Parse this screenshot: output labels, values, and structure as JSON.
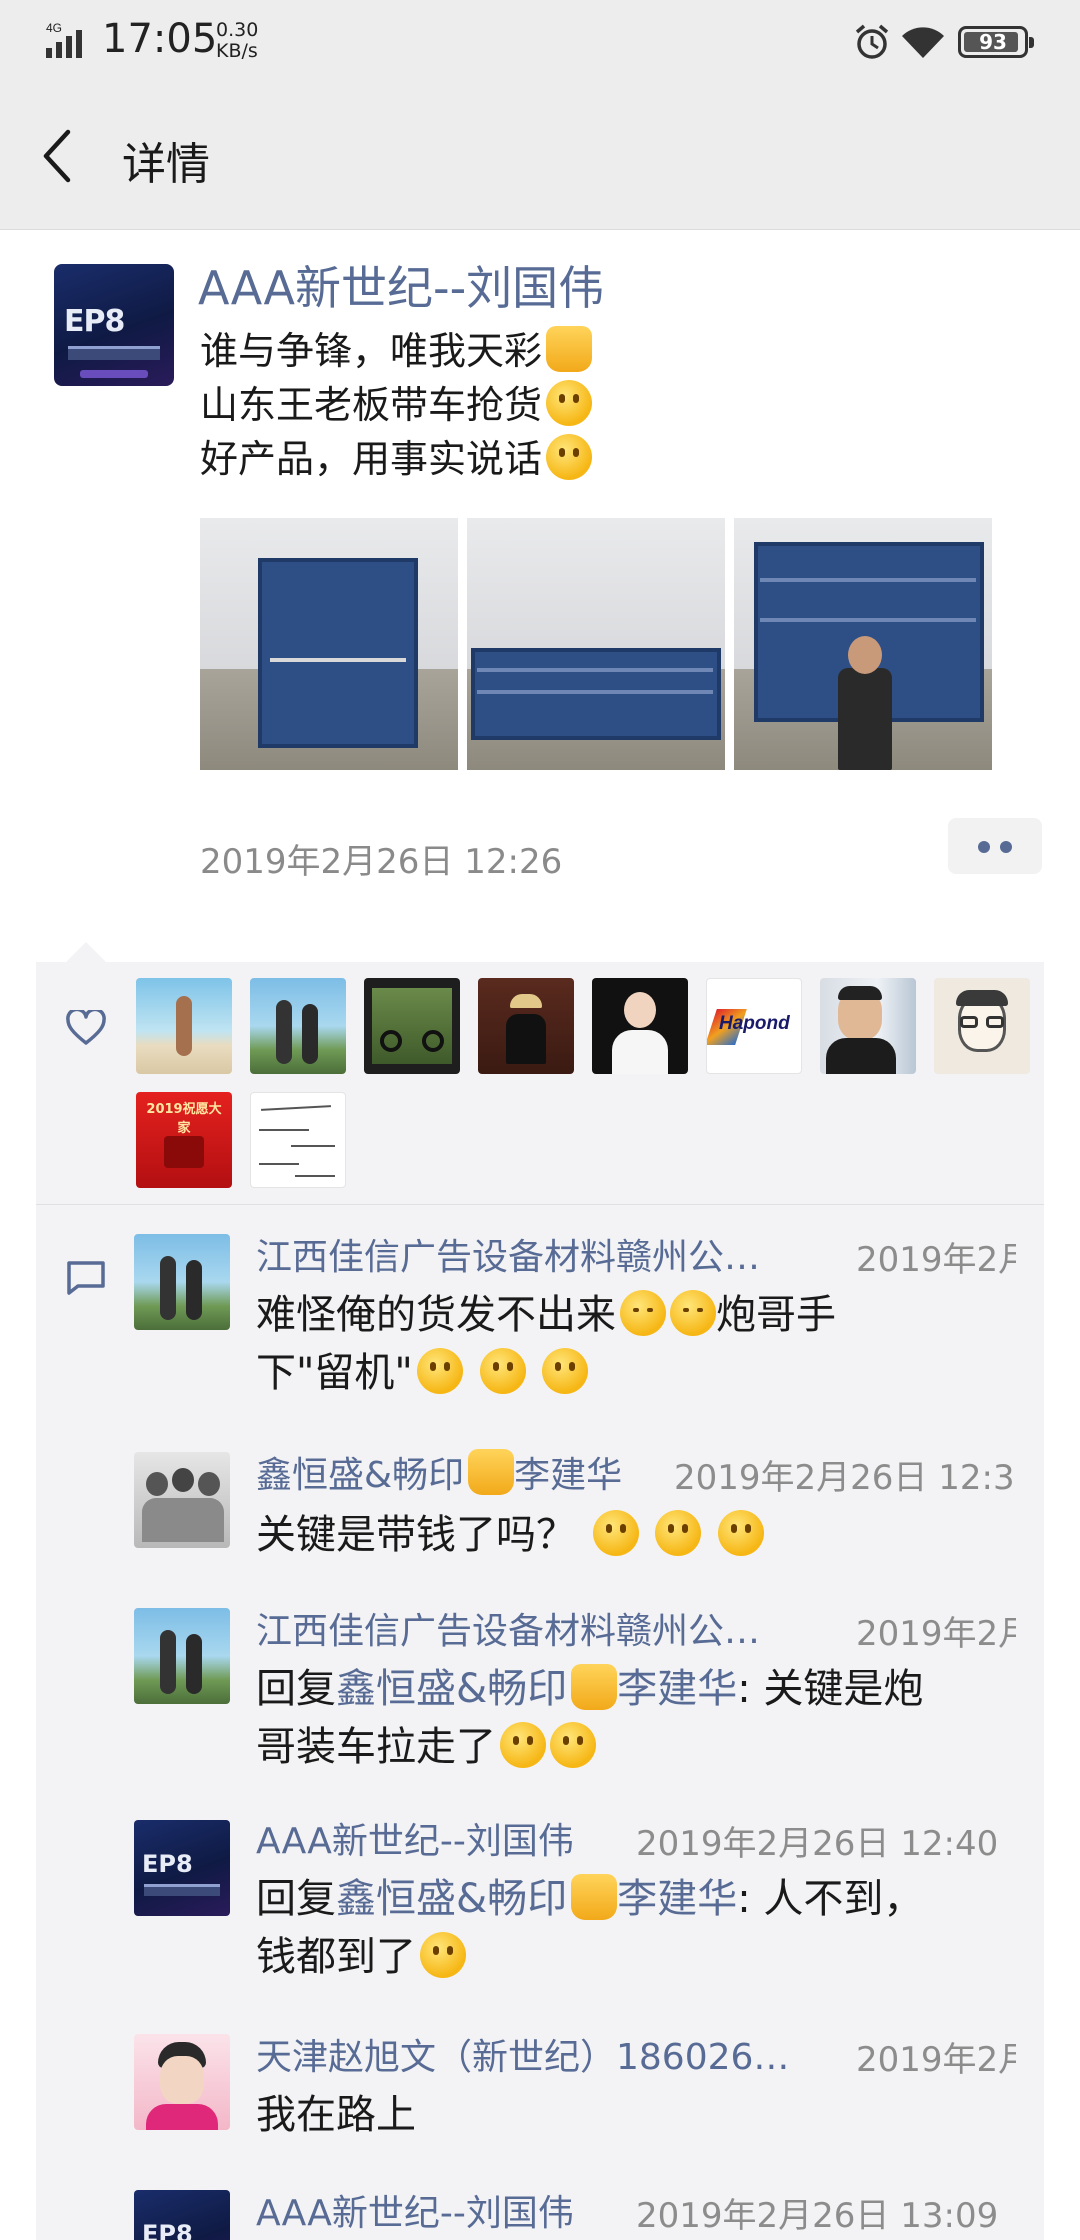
{
  "status_bar": {
    "network": "4G",
    "time": "17:05",
    "speed_value": "0.30",
    "speed_unit": "KB/s",
    "battery": "93",
    "battery_level": 0.93
  },
  "header": {
    "back_icon": "chevron-left-icon",
    "title": "详情"
  },
  "post": {
    "author": "AAA新世纪--刘国伟",
    "lines": [
      {
        "text": "谁与争锋，唯我天彩",
        "emoji": "thumbs-up"
      },
      {
        "text": "山东王老板带车抢货",
        "emoji": "smile"
      },
      {
        "text": "好产品，用事实说话",
        "emoji": "hand-over-mouth"
      }
    ],
    "avatar_text": "EP8",
    "time": "2019年2月26日 12:26"
  },
  "likes": {
    "icon": "heart-icon",
    "avatars": [
      {
        "label": "beach-runner"
      },
      {
        "label": "two-people-outdoor"
      },
      {
        "label": "motorcycle"
      },
      {
        "label": "hat-man"
      },
      {
        "label": "woman-portrait"
      },
      {
        "label": "hapond-logo",
        "text": "Hapond"
      },
      {
        "label": "man-glasses"
      },
      {
        "label": "cartoon-glasses"
      },
      {
        "label": "red-card",
        "text": "2019祝愿大家"
      },
      {
        "label": "handwriting"
      }
    ]
  },
  "comments": {
    "icon": "comment-icon",
    "items": [
      {
        "name": "江西佳信广告设备材料赣州公…",
        "time": "2019年2月",
        "text_lines": [
          "难怪俺的货发不出来",
          "下\"留机\""
        ],
        "text_suffix_1": "炮哥手"
      },
      {
        "name": "鑫恒盛&畅印",
        "name_suffix": "李建华",
        "time": "2019年2月26日 12:3",
        "text": "关键是带钱了吗？"
      },
      {
        "name": "江西佳信广告设备材料赣州公…",
        "time": "2019年2月",
        "reply_prefix": "回复",
        "reply_to": "鑫恒盛&畅印",
        "reply_to_suffix": "李建华",
        "text_a": ": 关键是炮",
        "text_b": "哥装车拉走了"
      },
      {
        "name": "AAA新世纪--刘国伟",
        "time": "2019年2月26日 12:40",
        "reply_prefix": "回复",
        "reply_to": "鑫恒盛&畅印",
        "reply_to_suffix": "李建华",
        "text_a": ": 人不到，",
        "text_b": "钱都到了"
      },
      {
        "name": "天津赵旭文（新世纪）186026…",
        "time": "2019年2月",
        "text": "我在路上"
      },
      {
        "name": "AAA新世纪--刘国伟",
        "time": "2019年2月26日 13:09"
      }
    ]
  }
}
